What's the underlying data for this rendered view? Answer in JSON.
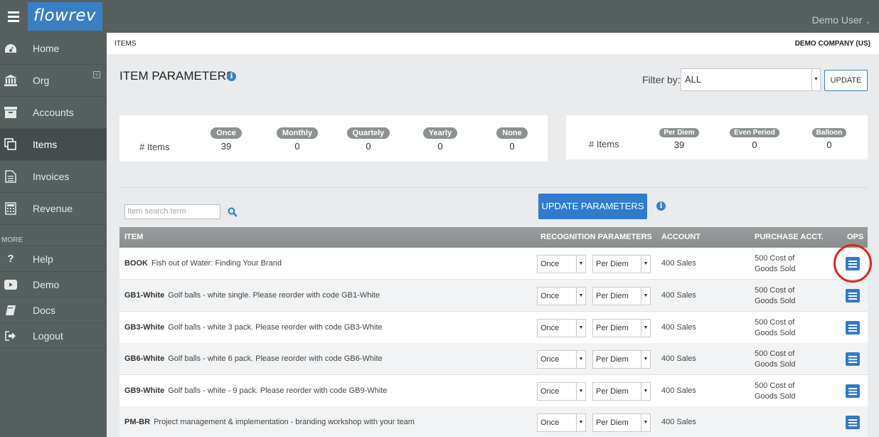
{
  "app": {
    "logo": "flowrev",
    "user": "Demo User"
  },
  "sidebar": {
    "items": [
      {
        "label": "Home",
        "icon": "dashboard-icon"
      },
      {
        "label": "Org",
        "icon": "bank-icon"
      },
      {
        "label": "Accounts",
        "icon": "archive-icon"
      },
      {
        "label": "Items",
        "icon": "copy-icon"
      },
      {
        "label": "Invoices",
        "icon": "document-icon"
      },
      {
        "label": "Revenue",
        "icon": "calculator-icon"
      }
    ],
    "more_label": "MORE",
    "more_items": [
      {
        "label": "Help",
        "icon": "question-icon"
      },
      {
        "label": "Demo",
        "icon": "video-icon"
      },
      {
        "label": "Docs",
        "icon": "book-icon"
      },
      {
        "label": "Logout",
        "icon": "logout-icon"
      }
    ]
  },
  "breadcrumb": "ITEMS",
  "company": "DEMO COMPANY (US)",
  "page": {
    "title": "ITEM PARAMETERS"
  },
  "filter": {
    "label": "Filter by:",
    "value": "ALL",
    "button": "UPDATE"
  },
  "stats_left": {
    "row_label": "# Items",
    "cols": [
      {
        "label": "Once",
        "value": "39"
      },
      {
        "label": "Monthly",
        "value": "0"
      },
      {
        "label": "Quartely",
        "value": "0"
      },
      {
        "label": "Yearly",
        "value": "0"
      },
      {
        "label": "None",
        "value": "0"
      }
    ]
  },
  "stats_right": {
    "row_label": "# Items",
    "cols": [
      {
        "label": "Per Diem",
        "value": "39"
      },
      {
        "label": "Even Period",
        "value": "0"
      },
      {
        "label": "Balloon",
        "value": "0"
      }
    ]
  },
  "search": {
    "placeholder": "Item search term"
  },
  "update_params_button": "UPDATE PARAMETERS",
  "table": {
    "headers": {
      "item": "ITEM",
      "recognition": "RECOGNITION PARAMETERS",
      "account": "ACCOUNT",
      "purchase": "PURCHASE ACCT.",
      "ops": "OPS"
    },
    "rows": [
      {
        "code": "BOOK",
        "desc": "Fish out of Water: Finding Your Brand",
        "freq": "Once",
        "method": "Per Diem",
        "account": "400 Sales",
        "purchase": "500 Cost of Goods Sold"
      },
      {
        "code": "GB1-White",
        "desc": "Golf balls - white single. Please reorder with code GB1-White",
        "freq": "Once",
        "method": "Per Diem",
        "account": "400 Sales",
        "purchase": "500 Cost of Goods Sold"
      },
      {
        "code": "GB3-White",
        "desc": "Golf balls - white 3 pack. Please reorder with code GB3-White",
        "freq": "Once",
        "method": "Per Diem",
        "account": "400 Sales",
        "purchase": "500 Cost of Goods Sold"
      },
      {
        "code": "GB6-White",
        "desc": "Golf balls - white 6 pack. Please reorder with code GB6-White",
        "freq": "Once",
        "method": "Per Diem",
        "account": "400 Sales",
        "purchase": "500 Cost of Goods Sold"
      },
      {
        "code": "GB9-White",
        "desc": "Golf balls - white - 9 pack. Please reorder with code GB9-White",
        "freq": "Once",
        "method": "Per Diem",
        "account": "400 Sales",
        "purchase": "500 Cost of Goods Sold"
      },
      {
        "code": "PM-BR",
        "desc": "Project management & implementation - branding workshop with your team",
        "freq": "Once",
        "method": "Per Diem",
        "account": "400 Sales",
        "purchase": ""
      }
    ]
  },
  "colors": {
    "accent": "#2f7bd0",
    "sidebar": "#55605f",
    "highlight": "#e0251b"
  }
}
